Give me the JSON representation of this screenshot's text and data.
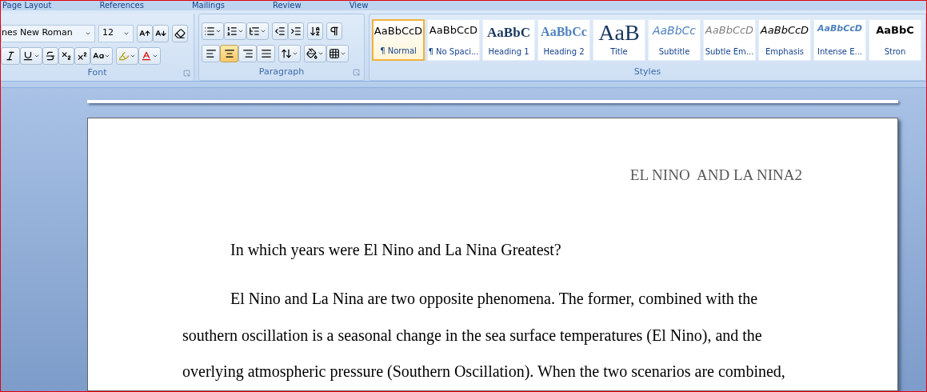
{
  "tabs": [
    {
      "label": "Page Layout"
    },
    {
      "label": "References"
    },
    {
      "label": "Mailings"
    },
    {
      "label": "Review"
    },
    {
      "label": "View"
    }
  ],
  "font_group": {
    "font_name": "nes New Roman",
    "font_size": "12",
    "label": "Font"
  },
  "paragraph_group": {
    "label": "Paragraph",
    "alignment": [
      {
        "kind": "left",
        "selected": false
      },
      {
        "kind": "center",
        "selected": true
      },
      {
        "kind": "right",
        "selected": false
      },
      {
        "kind": "justify",
        "selected": false
      }
    ]
  },
  "styles_group": {
    "label": "Styles",
    "styles": [
      {
        "kind": "normal",
        "preview": "AaBbCcD",
        "name": "¶ Normal",
        "selected": true
      },
      {
        "kind": "normal",
        "preview": "AaBbCcD",
        "name": "¶ No Spaci...",
        "selected": false
      },
      {
        "kind": "heading1",
        "preview": "AaBbC",
        "name": "Heading 1",
        "selected": false
      },
      {
        "kind": "heading2",
        "preview": "AaBbCc",
        "name": "Heading 2",
        "selected": false
      },
      {
        "kind": "title",
        "preview": "AaB",
        "name": "Title",
        "selected": false
      },
      {
        "kind": "subtitle",
        "preview": "AaBbCc",
        "name": "Subtitle",
        "selected": false
      },
      {
        "kind": "subtle",
        "preview": "AaBbCcD",
        "name": "Subtle Em...",
        "selected": false
      },
      {
        "kind": "emphasis",
        "preview": "AaBbCcD",
        "name": "Emphasis",
        "selected": false
      },
      {
        "kind": "intense",
        "preview": "AaBbCcD",
        "name": "Intense E...",
        "selected": false
      },
      {
        "kind": "strong",
        "preview": "AaBbC",
        "name": "Stron",
        "selected": false
      }
    ]
  },
  "document": {
    "header": "EL NINO  AND LA NINA2",
    "paragraphs": [
      {
        "kind": "heading",
        "text": "In which years were El Nino and La Nina Greatest?"
      },
      {
        "kind": "body",
        "text": "El Nino and La Nina are two opposite phenomena. The former, combined with the southern oscillation is a seasonal change in the sea surface temperatures (El Nino), and the overlying atmospheric pressure (Southern Oscillation). When the two scenarios are combined,"
      }
    ]
  }
}
